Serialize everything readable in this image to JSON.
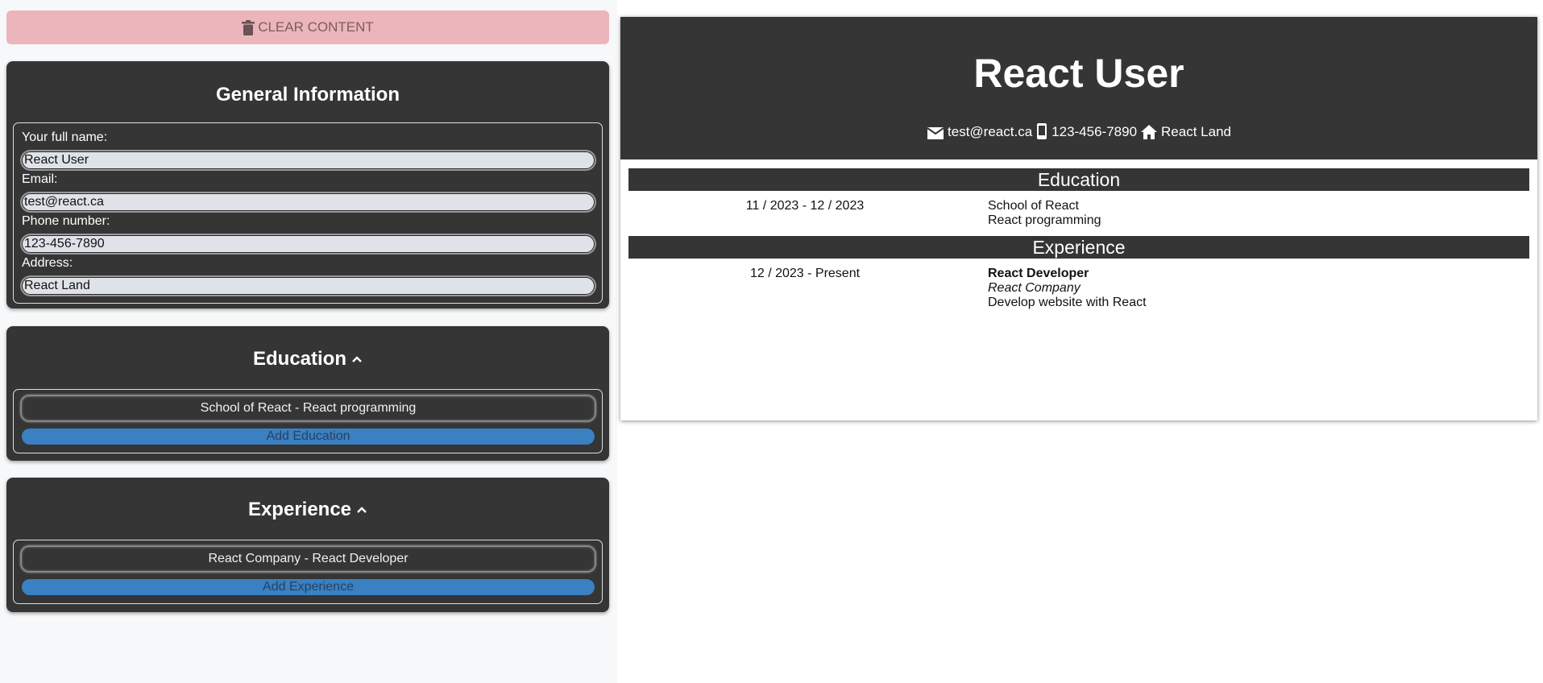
{
  "editor": {
    "clear_label": "CLEAR CONTENT",
    "general": {
      "title": "General Information",
      "fields": [
        {
          "label": "Your full name:",
          "value": "React User"
        },
        {
          "label": "Email:",
          "value": "test@react.ca"
        },
        {
          "label": "Phone number:",
          "value": "123-456-7890"
        },
        {
          "label": "Address:",
          "value": "React Land"
        }
      ]
    },
    "education": {
      "title": "Education",
      "items": [
        "School of React - React programming"
      ],
      "add_label": "Add Education"
    },
    "experience": {
      "title": "Experience",
      "items": [
        "React Company - React Developer"
      ],
      "add_label": "Add Experience"
    }
  },
  "resume": {
    "name": "React User",
    "email": "test@react.ca",
    "phone": "123-456-7890",
    "address": "React Land",
    "education": {
      "heading": "Education",
      "entries": [
        {
          "dates": "11 / 2023 - 12 / 2023",
          "school": "School of React",
          "program": "React programming"
        }
      ]
    },
    "experience": {
      "heading": "Experience",
      "entries": [
        {
          "dates": "12 / 2023 - Present",
          "position": "React Developer",
          "company": "React Company",
          "description": "Develop website with React"
        }
      ]
    }
  },
  "colors": {
    "dark_panel": "#353535",
    "clear_button": "#ecb5bb",
    "add_button": "#3a80c2",
    "input_bg": "#dfe3e9"
  },
  "icons": [
    "trash-icon",
    "chevron-up-icon",
    "mail-icon",
    "phone-icon",
    "home-icon"
  ]
}
